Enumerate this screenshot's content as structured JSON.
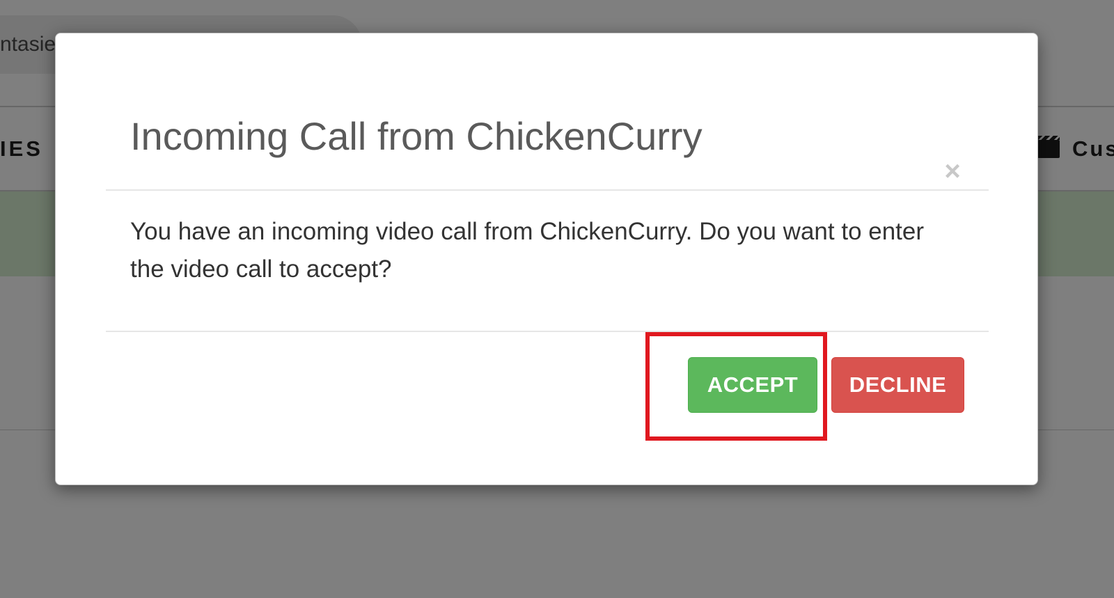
{
  "background": {
    "search_text": "ntasie",
    "nav_left_label": "IES",
    "nav_right_label": "Cus",
    "nav_right_icon": "clapperboard-icon"
  },
  "modal": {
    "title": "Incoming Call from ChickenCurry",
    "close_glyph": "×",
    "close_icon": "close-icon",
    "message": "You have an incoming video call from ChickenCurry. Do you want to enter the video call to accept?",
    "accept_label": "ACCEPT",
    "decline_label": "DECLINE"
  },
  "colors": {
    "accept": "#5cb85c",
    "decline": "#d9534f",
    "highlight": "#e0181f",
    "overlay": "rgba(0,0,0,0.5)"
  }
}
